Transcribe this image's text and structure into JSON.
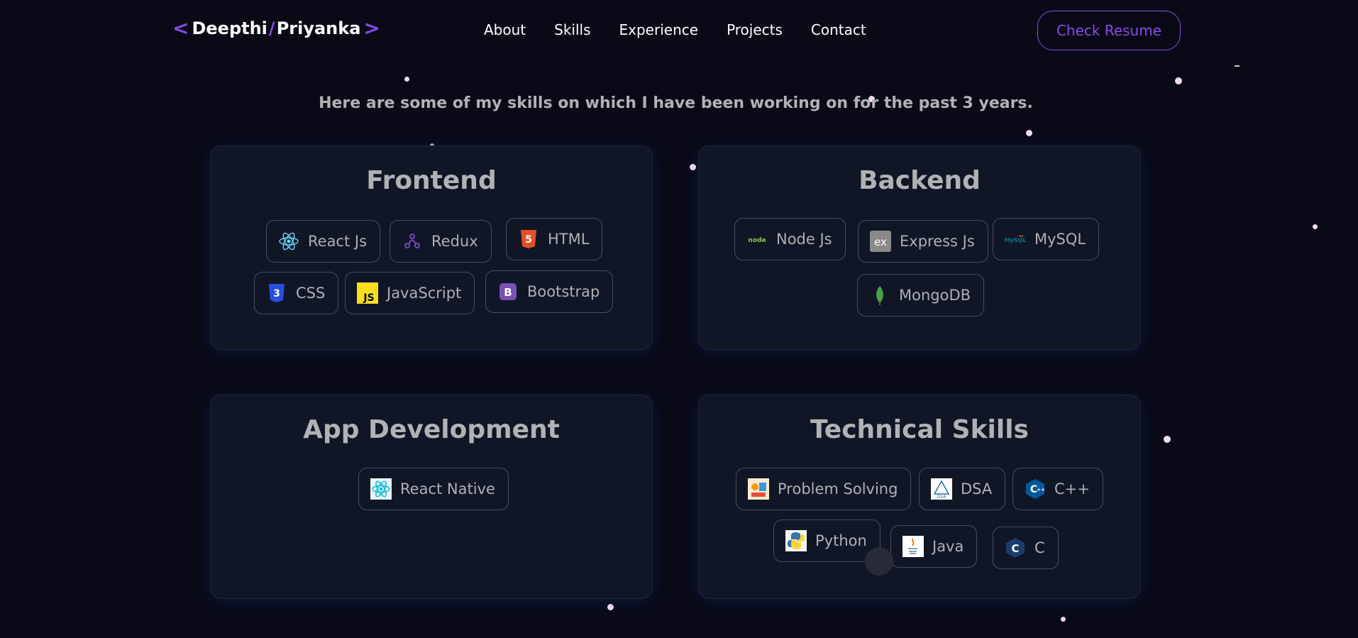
{
  "header": {
    "logo": {
      "left": "<",
      "first": "Deepthi",
      "slash": "/",
      "last": "Priyanka",
      "right": ">"
    },
    "nav": [
      "About",
      "Skills",
      "Experience",
      "Projects",
      "Contact"
    ],
    "resume_button": "Check Resume"
  },
  "subtitle": "Here are some of my skills on which I have been working on for the past 3 years.",
  "categories": [
    {
      "title": "Frontend",
      "skills": [
        {
          "name": "React Js",
          "icon": "react-icon"
        },
        {
          "name": "Redux",
          "icon": "redux-icon"
        },
        {
          "name": "HTML",
          "icon": "html5-icon"
        },
        {
          "name": "CSS",
          "icon": "css3-icon"
        },
        {
          "name": "JavaScript",
          "icon": "javascript-icon"
        },
        {
          "name": "Bootstrap",
          "icon": "bootstrap-icon"
        }
      ]
    },
    {
      "title": "Backend",
      "skills": [
        {
          "name": "Node Js",
          "icon": "nodejs-icon"
        },
        {
          "name": "Express Js",
          "icon": "express-icon"
        },
        {
          "name": "MySQL",
          "icon": "mysql-icon"
        },
        {
          "name": "MongoDB",
          "icon": "mongodb-icon"
        }
      ]
    },
    {
      "title": "App Development",
      "skills": [
        {
          "name": "React Native",
          "icon": "react-native-icon"
        }
      ]
    },
    {
      "title": "Technical Skills",
      "skills": [
        {
          "name": "Problem Solving",
          "icon": "problem-solving-icon"
        },
        {
          "name": "DSA",
          "icon": "dsa-icon"
        },
        {
          "name": "C++",
          "icon": "cpp-icon"
        },
        {
          "name": "Python",
          "icon": "python-icon"
        },
        {
          "name": "Java",
          "icon": "java-icon"
        },
        {
          "name": "C",
          "icon": "c-icon"
        }
      ]
    }
  ],
  "colors": {
    "accent": "#854ce6",
    "background": "#0a0a17",
    "card": "#111626",
    "muted_text": "#b1b2b3"
  }
}
